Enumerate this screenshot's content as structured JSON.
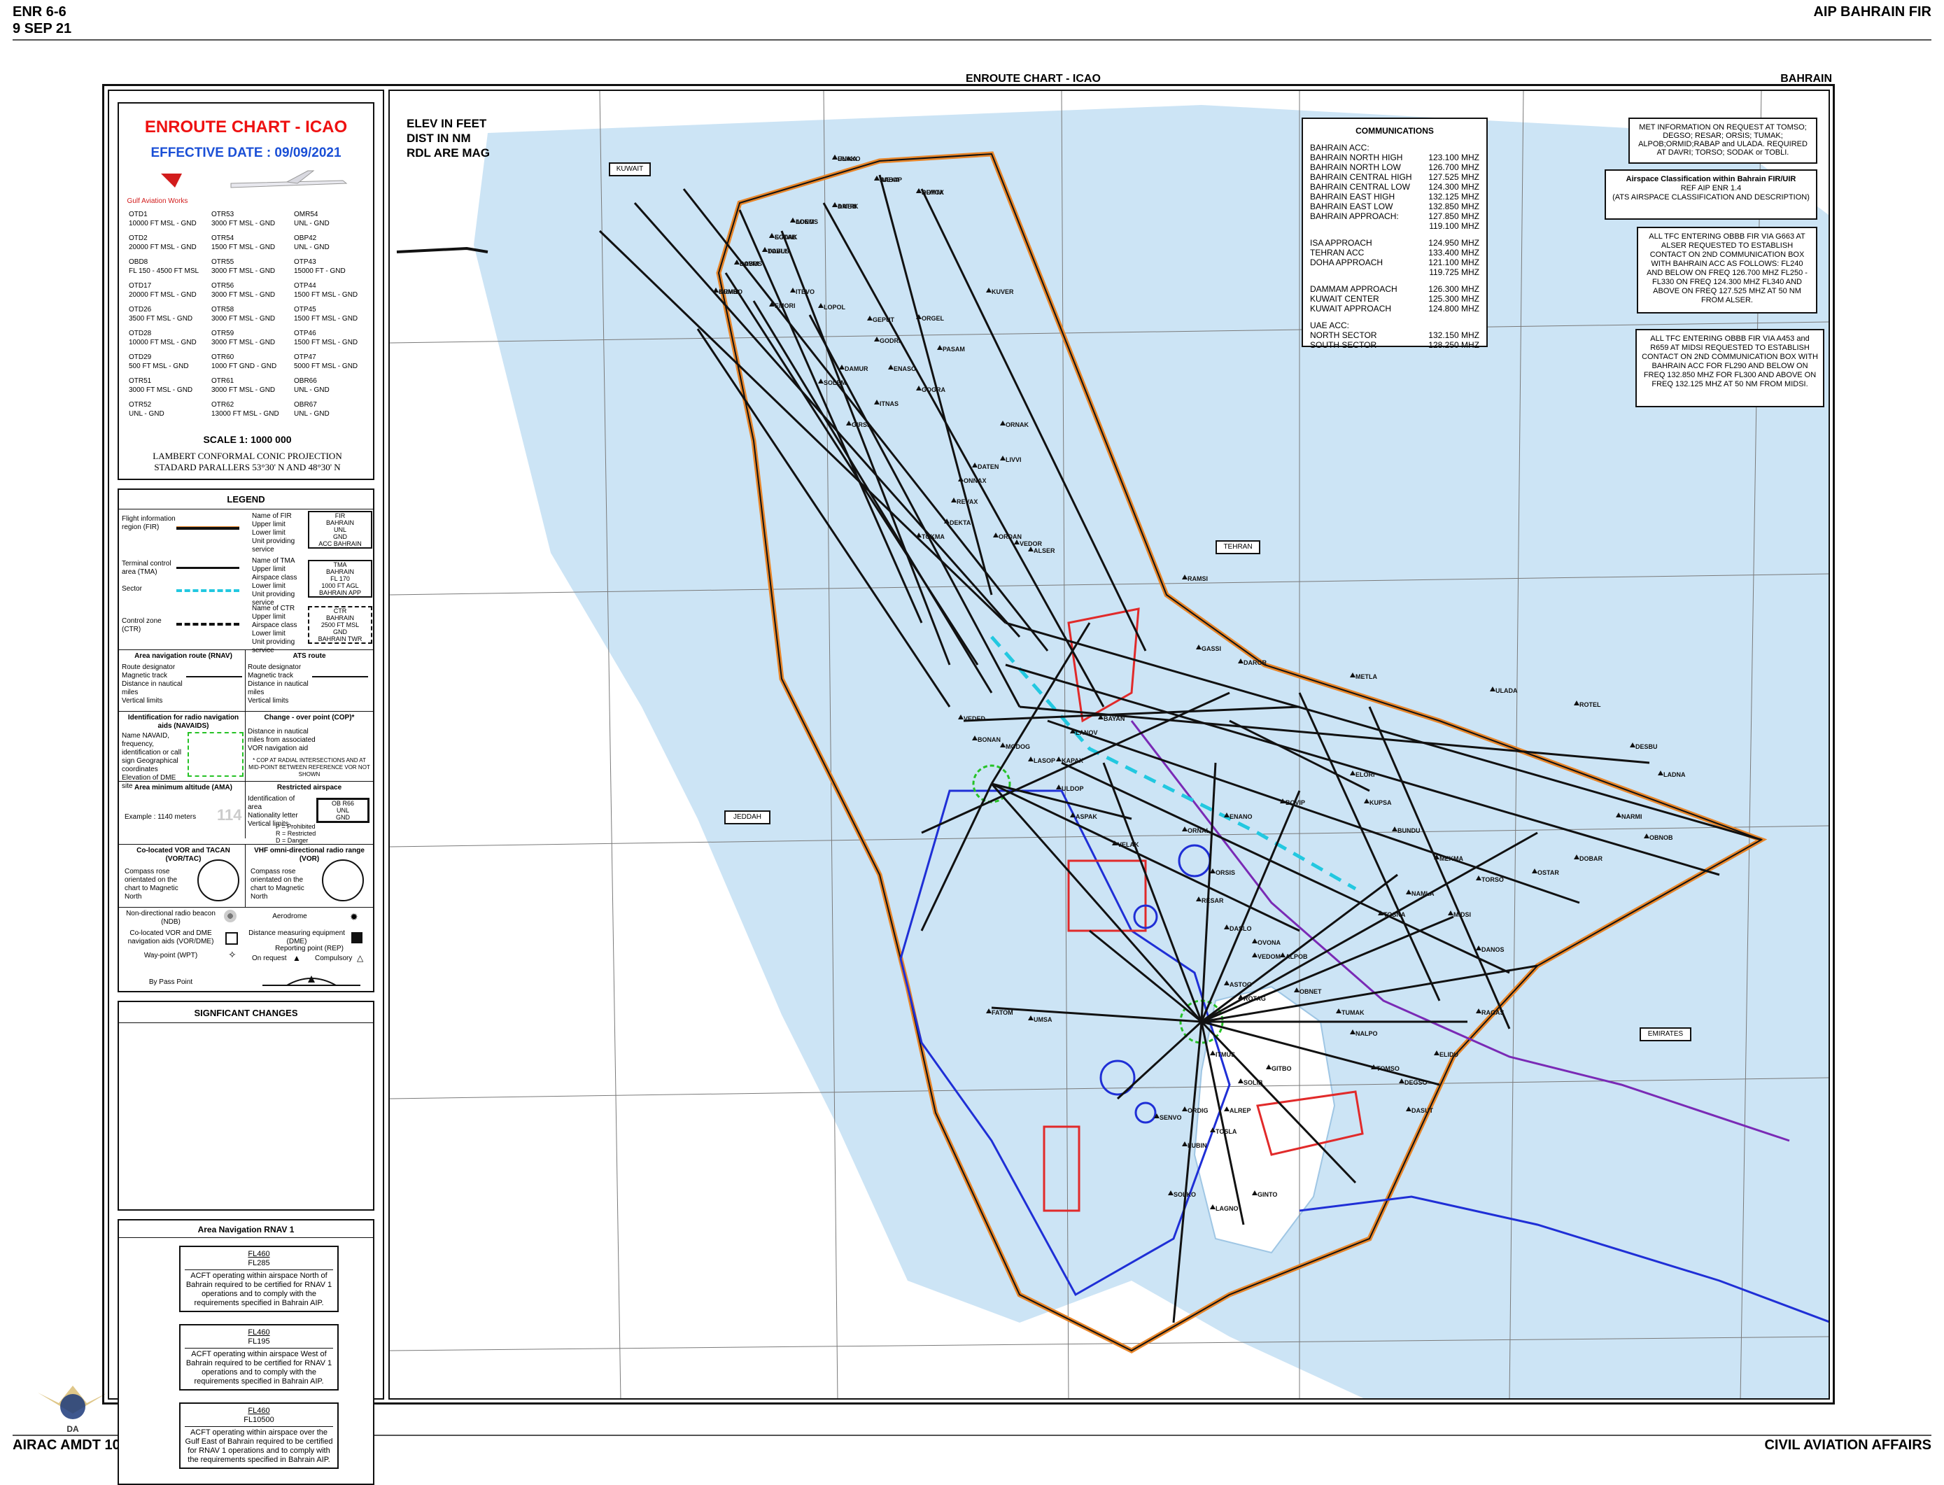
{
  "header": {
    "page_code": "ENR 6-6",
    "date": "9 SEP 21",
    "publication": "AIP BAHRAIN FIR",
    "footer_left": "AIRAC AMDT 10/21",
    "footer_right": "CIVIL AVIATION AFFAIRS",
    "chart_title": "ENROUTE CHART - ICAO",
    "chart_region": "BAHRAIN"
  },
  "titlebox": {
    "title": "ENROUTE CHART - ICAO",
    "effective": "EFFECTIVE DATE : 09/09/2021",
    "logo_caption": "Gulf Aviation Works",
    "scale": "SCALE  1: 1000 000",
    "projection": "LAMBERT CONFORMAL CONIC PROJECTION",
    "parallels": "STADARD PARALLERS 53°30' N  AND 48°30' N",
    "areas": [
      [
        "OTD1",
        "10000 FT MSL - GND"
      ],
      [
        "OTD2",
        "20000 FT MSL - GND"
      ],
      [
        "OBD8",
        "FL 150 - 4500 FT MSL"
      ],
      [
        "OTD17",
        "20000 FT MSL - GND"
      ],
      [
        "OTD26",
        "3500 FT MSL - GND"
      ],
      [
        "OTD28",
        "10000 FT MSL - GND"
      ],
      [
        "OTD29",
        "500 FT MSL - GND"
      ],
      [
        "OTR51",
        "3000 FT MSL - GND"
      ],
      [
        "OTR52",
        "UNL - GND"
      ],
      [
        "OTR53",
        "3000 FT MSL - GND"
      ],
      [
        "OTR54",
        "1500 FT MSL - GND"
      ],
      [
        "OTR55",
        "3000 FT MSL - GND"
      ],
      [
        "OTR56",
        "3000 FT MSL - GND"
      ],
      [
        "OTR58",
        "3000 FT MSL - GND"
      ],
      [
        "OTR59",
        "3000 FT MSL - GND"
      ],
      [
        "OTR60",
        "1000 FT GND - GND"
      ],
      [
        "OTR61",
        "3000 FT MSL - GND"
      ],
      [
        "OTR62",
        "13000 FT MSL - GND"
      ],
      [
        "OMR54",
        "UNL - GND"
      ],
      [
        "OBP42",
        "UNL - GND"
      ],
      [
        "OTP43",
        "15000 FT - GND"
      ],
      [
        "OTP44",
        "1500 FT MSL - GND"
      ],
      [
        "OTP45",
        "1500 FT MSL - GND"
      ],
      [
        "OTP46",
        "1500 FT MSL - GND"
      ],
      [
        "OTP47",
        "5000 FT MSL - GND"
      ],
      [
        "OBR66",
        "UNL - GND"
      ],
      [
        "OBR67",
        "UNL - GND"
      ]
    ]
  },
  "legend": {
    "title": "LEGEND",
    "fir_label": "Flight information region (FIR)",
    "fir_desc": "Name of FIR\nUpper limit\nLower limit\nUnit providing service",
    "fir_sample": "FIR\nBAHRAIN\nUNL\nGND\nACC BAHRAIN",
    "tma_label": "Terminal control area (TMA)",
    "tma_desc": "Name of TMA\nUpper limit\nAirspace class\nLower limit\nUnit providing service",
    "tma_sample": "TMA\nBAHRAIN\nFL 170\n1000 FT AGL\nBAHRAIN APP",
    "sector_label": "Sector",
    "ctr_label": "Control zone (CTR)",
    "ctr_desc": "Name of CTR\nUpper limit\nAirspace class\nLower limit\nUnit providing service",
    "ctr_sample": "CTR\nBAHRAIN\n2500 FT MSL\nGND\nBAHRAIN TWR",
    "rnav_route": "Area navigation route (RNAV)",
    "ats_route": "ATS route",
    "route_desc": "Route designator\nMagnetic track\nDistance in nautical miles\nVertical limits",
    "navaid_id": "Identification for radio navigation aids (NAVAIDS)",
    "navaid_desc": "Name\nNAVAID, frequency, identification or call sign\nGeographical coordinates\nElevation of DME site",
    "cop": "Change - over point (COP)*",
    "cop_desc": "Distance in nautical miles from associated VOR navigation aid",
    "cop_note": "* COP AT RADIAL INTERSECTIONS AND AT MID-POINT BETWEEN REFERENCE VOR NOT SHOWN",
    "ama": "Area minimum altitude (AMA)",
    "ama_example": "Example : 1140 meters",
    "ama_value": "114",
    "restricted": "Restricted airspace",
    "restricted_desc": "Identification of area\nNationality letter\nVertical limits",
    "restricted_sample": "OB R66\nUNL\nGND",
    "restricted_key": "P = Prohibited\nR = Restricted\nD = Danger",
    "vortac": "Co-located VOR and TACAN (VOR/TAC)",
    "vor_range": "VHF omni-directional radio range (VOR)",
    "rose_desc": "Compass rose orientated on the chart to Magnetic North",
    "ndb": "Non-directional radio beacon (NDB)",
    "aerodrome": "Aerodrome",
    "vordme": "Co-located VOR and DME navigation aids (VOR/DME)",
    "dme": "Distance measuring equipment (DME)",
    "wpt": "Way-point (WPT)",
    "rep": "Reporting point (REP)",
    "on_request": "On request",
    "compulsory": "Compulsory",
    "flyby": "By Pass Point"
  },
  "changes": {
    "title": "SIGNFICANT CHANGES"
  },
  "rnav1": {
    "title": "Area Navigation RNAV 1",
    "boxes": [
      {
        "upper": "FL460",
        "lower": "FL285",
        "text": "ACFT operating within airspace North of Bahrain required to be certified for RNAV 1 operations and to comply with the requirements specified in Bahrain AIP."
      },
      {
        "upper": "FL460",
        "lower": "FL195",
        "text": "ACFT operating within airspace West of Bahrain required to be certified for RNAV 1 operations and to comply with the requirements specified in Bahrain AIP."
      },
      {
        "upper": "FL460",
        "lower": "FL10500",
        "text": "ACFT operating within airspace over the Gulf East of Bahrain required to be certified for RNAV 1 operations and to comply with the requirements specified in Bahrain AIP."
      }
    ]
  },
  "map": {
    "elev_note": [
      "ELEV IN FEET",
      "DIST IN NM",
      "RDL ARE MAG"
    ],
    "communications": {
      "title": "COMMUNICATIONS",
      "groups": [
        {
          "name": "BAHRAIN ACC:",
          "rows": [
            [
              "BAHRAIN NORTH HIGH",
              "123.100 MHZ"
            ],
            [
              "BAHRAIN NORTH LOW",
              "126.700 MHZ"
            ],
            [
              "BAHRAIN CENTRAL HIGH",
              "127.525 MHZ"
            ],
            [
              "BAHRAIN CENTRAL LOW",
              "124.300 MHZ"
            ],
            [
              "BAHRAIN EAST HIGH",
              "132.125 MHZ"
            ],
            [
              "BAHRAIN EAST LOW",
              "132.850 MHZ"
            ],
            [
              "BAHRAIN APPROACH:",
              "127.850 MHZ"
            ],
            [
              "",
              "119.100 MHZ"
            ]
          ]
        },
        {
          "name": "",
          "rows": [
            [
              "ISA APPROACH",
              "124.950 MHZ"
            ],
            [
              "TEHRAN ACC",
              "133.400 MHZ"
            ],
            [
              "DOHA APPROACH",
              "121.100 MHZ"
            ],
            [
              "",
              "119.725 MHZ"
            ]
          ]
        },
        {
          "name": "",
          "rows": [
            [
              "DAMMAM APPROACH",
              "126.300 MHZ"
            ],
            [
              "KUWAIT CENTER",
              "125.300 MHZ"
            ],
            [
              "KUWAIT APPROACH",
              "124.800 MHZ"
            ]
          ]
        },
        {
          "name": "UAE ACC:",
          "rows": [
            [
              "NORTH SECTOR",
              "132.150 MHZ"
            ],
            [
              "SOUTH SECTOR",
              "128.250 MHZ"
            ]
          ]
        }
      ]
    },
    "met_info": "MET INFORMATION ON REQUEST AT TOMSO; DEGSO; RESAR; ORSIS; TUMAK; ALPOB;ORMID;RABAP and ULADA. REQUIRED AT DAVRI; TORSO; SODAK or TOBLI.",
    "airspace_class": {
      "title": "Airspace Classification within Bahrain FIR/UIR",
      "ref": "REF AIP ENR 1.4",
      "note": "(ATS AIRSPACE CLASSIFICATION AND DESCRIPTION)"
    },
    "tfc_alser": "ALL TFC ENTERING OBBB FIR VIA G663 AT ALSER REQUESTED TO ESTABLISH CONTACT ON 2ND COMMUNICATION BOX WITH BAHRAIN ACC AS FOLLOWS: FL240 AND BELOW ON FREQ 126.700 MHZ FL250 - FL330 ON FREQ 124.300 MHZ FL340 AND ABOVE ON FREQ 127.525 MHZ AT 50 NM FROM ALSER.",
    "tfc_midsi": "ALL TFC ENTERING OBBB FIR VIA A453 and R659 AT MIDSI REQUESTED TO ESTABLISH CONTACT ON 2ND COMMUNICATION BOX WITH BAHRAIN ACC FOR FL290 AND BELOW ON FREQ 132.850 MHZ FOR FL300 AND ABOVE ON FREQ 132.125 MHZ AT 50 NM FROM MIDSI.",
    "region_boxes": [
      "KUWAIT",
      "TEHRAN",
      "JEDDAH",
      "EMIRATES"
    ],
    "waypoints": [
      "ENAKO",
      "RABAP",
      "ROTOX",
      "AMBIK",
      "LONOS",
      "EGTAB",
      "DAVUS",
      "SOBUS",
      "KUMBO",
      "ITEVO",
      "EMORI",
      "LOPOL",
      "GEPUT",
      "ORGEL",
      "PASAM",
      "KUVER",
      "GODRI",
      "DAMUR",
      "ENASO",
      "SOLEM",
      "GOGRA",
      "ITNAS",
      "GIRSI",
      "ORNAK",
      "LIVVI",
      "DATEN",
      "ONNAX",
      "REVAX",
      "DEKTA",
      "TOKMA",
      "ORDAN",
      "VEDOR",
      "ALSER",
      "RAMSI",
      "GASSI",
      "DAROR",
      "METLA",
      "ULADA",
      "ROTEL",
      "DESBU",
      "LADNA",
      "NARMI",
      "OBNOB",
      "DOBAR",
      "OSTAR",
      "TORSO",
      "MIDSI",
      "DANOS",
      "RAGAS",
      "ELIDU",
      "DASUT",
      "DEGSO",
      "TOMSO",
      "NALPO",
      "TUMAK",
      "OBNET",
      "ALPOB",
      "ASTOG",
      "OVONA",
      "TOSNA",
      "NAMLA",
      "MEKMA",
      "BUNDU",
      "KUPSA",
      "ELORI",
      "BOVIP",
      "ENANO",
      "ORNAL",
      "ORSIS",
      "RESAR",
      "DASLO",
      "VEDOM",
      "ROTAG",
      "ITMUS",
      "VELAK",
      "ASPAK",
      "ULDOP",
      "LASOP",
      "MODOG",
      "BONAN",
      "VEDED",
      "KAPAX",
      "LANOV",
      "BAYAN",
      "UMSA",
      "FATOM",
      "SENVO",
      "LUBIN",
      "SOLKO",
      "TOSLA",
      "ORDIG",
      "ALREP",
      "SOLIB",
      "GITBO",
      "LAGNO",
      "GINTO",
      "ULIKA",
      "IMEXA",
      "DEMTA",
      "DATRI",
      "ADEM",
      "SODAK",
      "TOBLI",
      "DAVRI",
      "ORMID"
    ]
  },
  "colors": {
    "sea": "#cce4f5",
    "fir": "#e8862a",
    "route": "#111111",
    "sector": "#22c8e0",
    "restricted_red": "#e12a2a",
    "tma_blue": "#1f2fd6",
    "purple": "#7a2ab5",
    "green": "#26c226"
  }
}
